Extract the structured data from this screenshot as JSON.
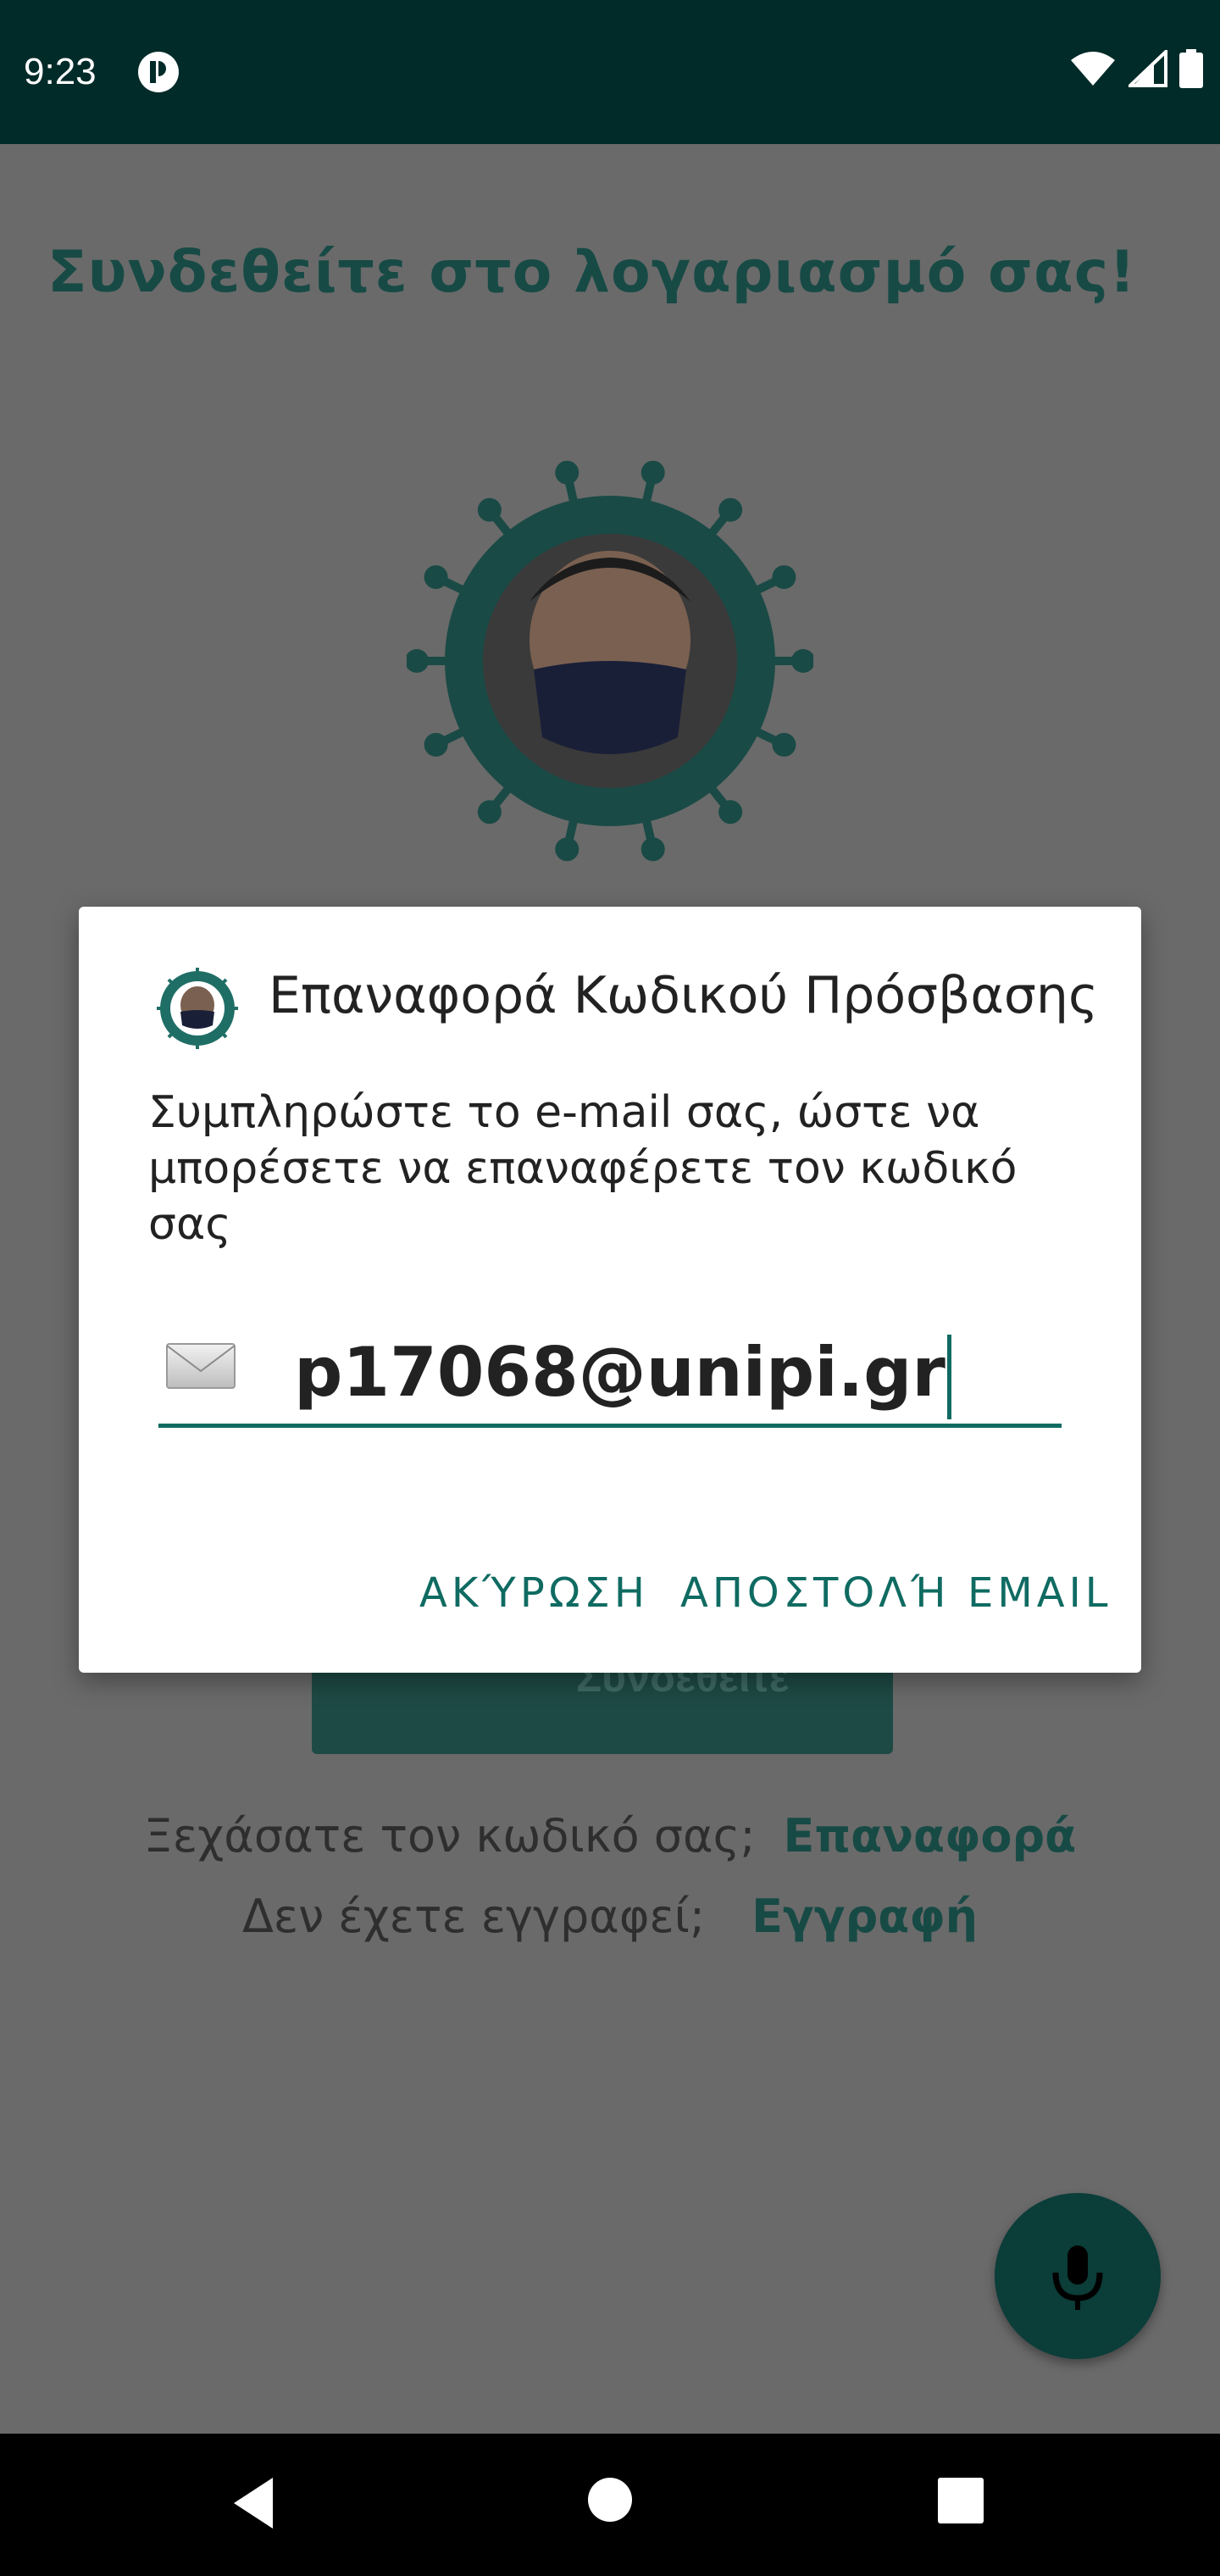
{
  "status_bar": {
    "time": "9:23",
    "icons": [
      "app-notification-icon",
      "wifi-icon",
      "cell-signal-icon",
      "battery-icon"
    ]
  },
  "screen": {
    "title": "Συνδεθείτε στο λογαριασμό σας!",
    "logo": "mask-virus-logo",
    "login_button": "Συνδεθείτε",
    "forgot_text": "Ξεχάσατε τον κωδικό σας;",
    "forgot_link": "Επαναφορά",
    "signup_text": "Δεν έχετε εγγραφεί;",
    "signup_link": "Εγγραφή",
    "fab_icon": "microphone-icon"
  },
  "dialog": {
    "title": "Επαναφορά Κωδικού Πρόσβασης",
    "message": "Συμπληρώστε το e-mail σας, ώστε να μπορέσετε να επαναφέρετε τον κωδικό σας",
    "email_value": "p17068@unipi.gr",
    "email_icon": "envelope-icon",
    "cancel_label": "ΑΚΎΡΩΣΗ",
    "send_label": "ΑΠΟΣΤΟΛΉ EMAIL"
  },
  "nav_bar": {
    "icons": [
      "back-icon",
      "home-icon",
      "recents-icon"
    ]
  },
  "colors": {
    "status_bar": "#002b29",
    "accent": "#0f6b62",
    "scrim": "#6a6a6a"
  }
}
